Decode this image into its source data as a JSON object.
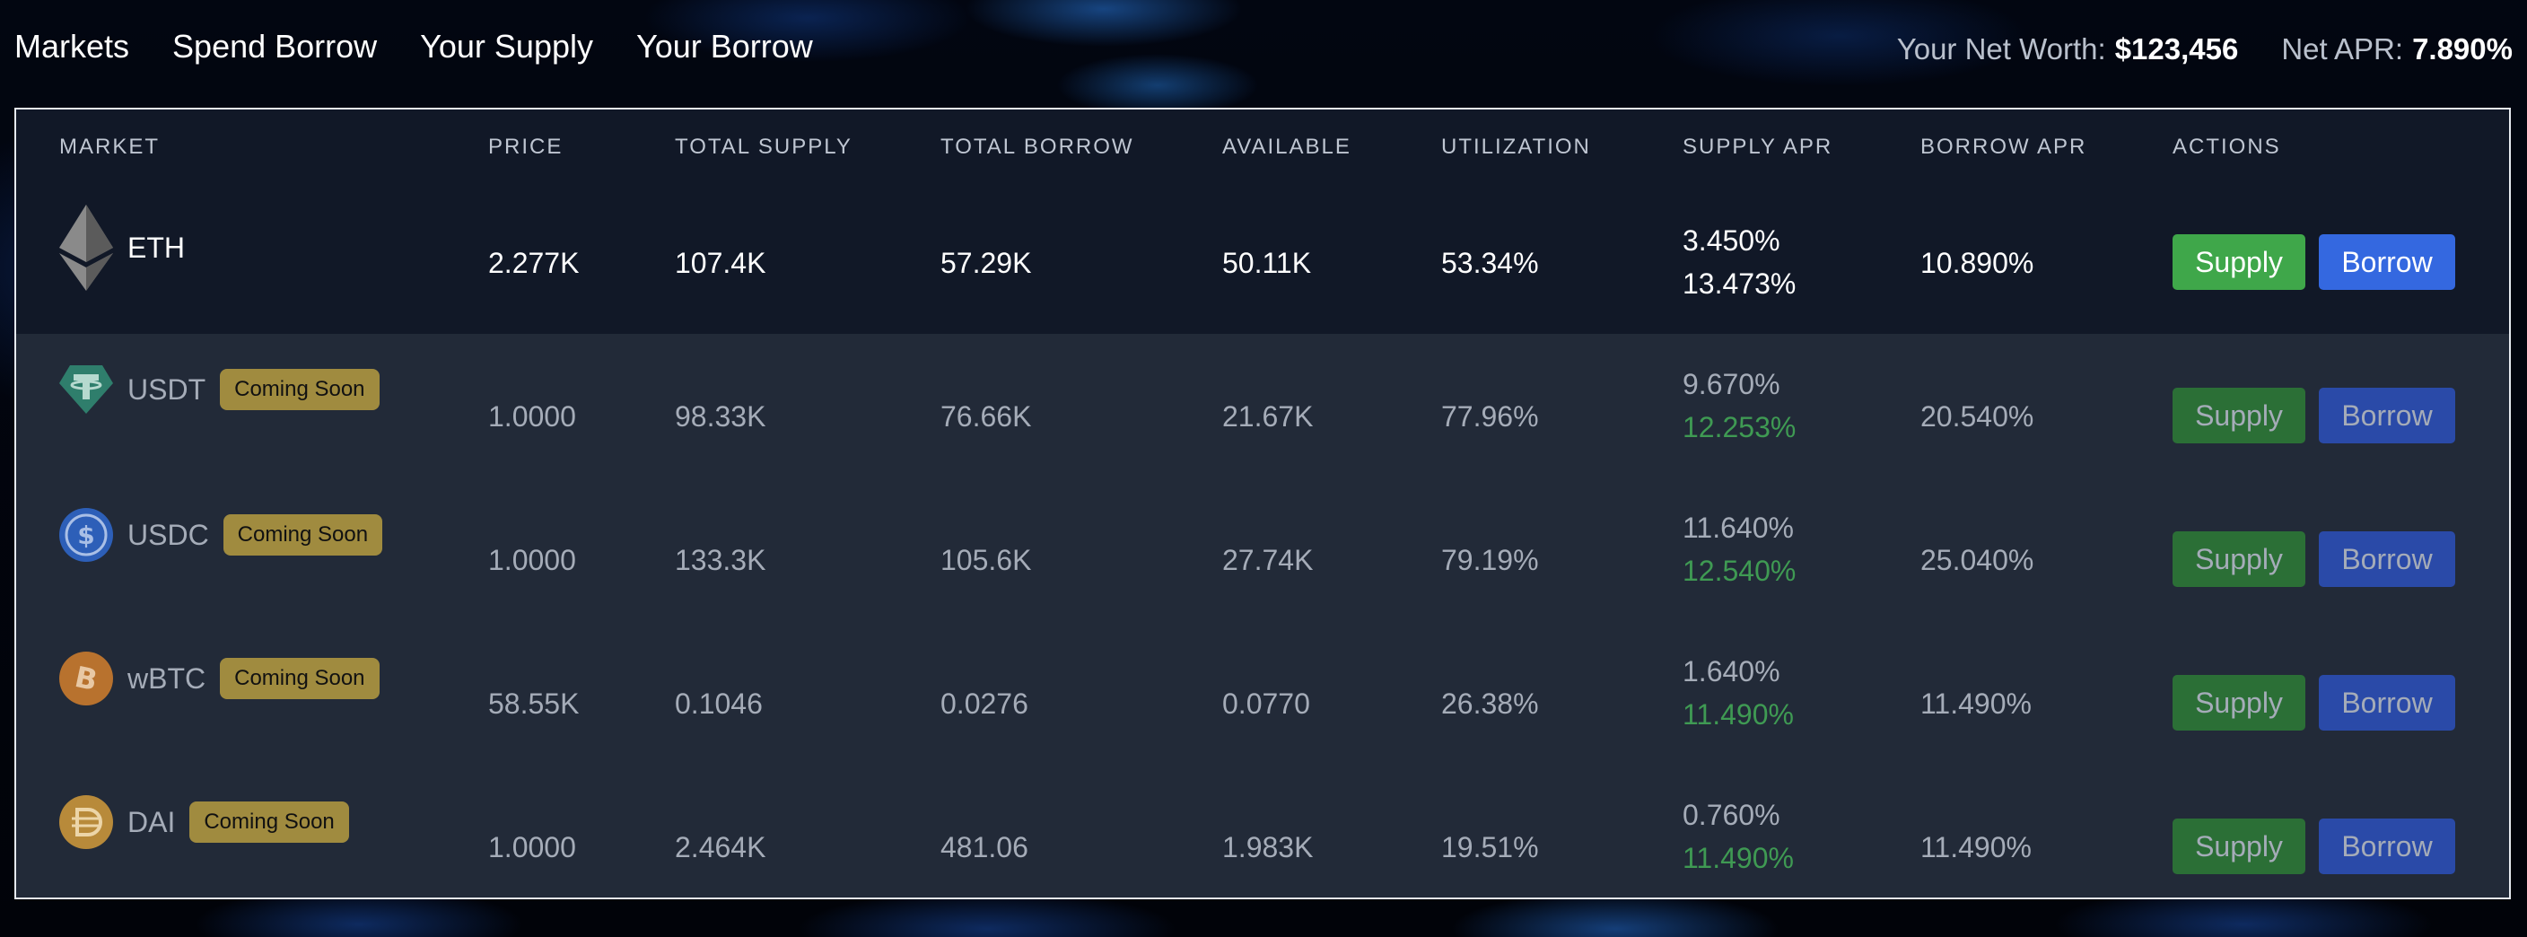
{
  "nav": {
    "items": [
      "Markets",
      "Spend Borrow",
      "Your Supply",
      "Your Borrow"
    ]
  },
  "stats": {
    "net_worth_label": "Your Net Worth:",
    "net_worth_value": "$123,456",
    "net_apr_label": "Net APR:",
    "net_apr_value": "7.890%"
  },
  "table": {
    "headers": [
      "MARKET",
      "PRICE",
      "TOTAL SUPPLY",
      "TOTAL BORROW",
      "AVAILABLE",
      "UTILIZATION",
      "SUPPLY APR",
      "BORROW APR",
      "ACTIONS"
    ],
    "rows": [
      {
        "symbol": "ETH",
        "icon": "ethereum-icon",
        "badge": "",
        "price": "2.277K",
        "total_supply": "107.4K",
        "total_borrow": "57.29K",
        "available": "50.11K",
        "utilization": "53.34%",
        "supply_apr": "3.450%",
        "supply_apr_boost": "13.473%",
        "borrow_apr": "10.890%",
        "supply_label": "Supply",
        "borrow_label": "Borrow"
      },
      {
        "symbol": "USDT",
        "icon": "tether-icon",
        "badge": "Coming Soon",
        "price": "1.0000",
        "total_supply": "98.33K",
        "total_borrow": "76.66K",
        "available": "21.67K",
        "utilization": "77.96%",
        "supply_apr": "9.670%",
        "supply_apr_boost": "12.253%",
        "borrow_apr": "20.540%",
        "supply_label": "Supply",
        "borrow_label": "Borrow"
      },
      {
        "symbol": "USDC",
        "icon": "usdc-icon",
        "badge": "Coming Soon",
        "price": "1.0000",
        "total_supply": "133.3K",
        "total_borrow": "105.6K",
        "available": "27.74K",
        "utilization": "79.19%",
        "supply_apr": "11.640%",
        "supply_apr_boost": "12.540%",
        "borrow_apr": "25.040%",
        "supply_label": "Supply",
        "borrow_label": "Borrow"
      },
      {
        "symbol": "wBTC",
        "icon": "bitcoin-icon",
        "badge": "Coming Soon",
        "price": "58.55K",
        "total_supply": "0.1046",
        "total_borrow": "0.0276",
        "available": "0.0770",
        "utilization": "26.38%",
        "supply_apr": "1.640%",
        "supply_apr_boost": "11.490%",
        "borrow_apr": "11.490%",
        "supply_label": "Supply",
        "borrow_label": "Borrow"
      },
      {
        "symbol": "DAI",
        "icon": "dai-icon",
        "badge": "Coming Soon",
        "price": "1.0000",
        "total_supply": "2.464K",
        "total_borrow": "481.06",
        "available": "1.983K",
        "utilization": "19.51%",
        "supply_apr": "0.760%",
        "supply_apr_boost": "11.490%",
        "borrow_apr": "11.490%",
        "supply_label": "Supply",
        "borrow_label": "Borrow"
      }
    ]
  },
  "colors": {
    "supply_button": "#3fa74a",
    "borrow_button": "#3468e0",
    "boost_apr": "#4ade80",
    "badge": "#a08b3f",
    "panel": "#222a38",
    "header": "#111827"
  }
}
